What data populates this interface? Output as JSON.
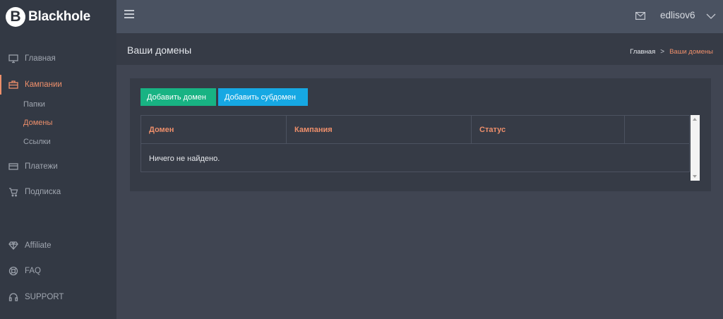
{
  "brand": {
    "logo_letter": "B",
    "name": "Blackhole"
  },
  "sidebar": {
    "items": [
      {
        "label": "Главная",
        "icon": "monitor-icon"
      },
      {
        "label": "Кампании",
        "icon": "briefcase-icon",
        "active": true
      },
      {
        "label": "Платежи",
        "icon": "credit-card-icon"
      },
      {
        "label": "Подписка",
        "icon": "cart-icon"
      },
      {
        "label": "Affiliate",
        "icon": "diamond-icon"
      },
      {
        "label": "FAQ",
        "icon": "lifebuoy-icon"
      },
      {
        "label": "SUPPORT",
        "icon": "headset-icon"
      }
    ],
    "sub_items": [
      {
        "label": "Папки"
      },
      {
        "label": "Домены",
        "active": true
      },
      {
        "label": "Ссылки"
      }
    ]
  },
  "topbar": {
    "username": "edlisov6",
    "menu_icon": "hamburger-icon",
    "mail_icon": "mail-icon",
    "dropdown_icon": "chevron-down-icon"
  },
  "page": {
    "title": "Ваши домены",
    "breadcrumb": {
      "home": "Главная",
      "separator": ">",
      "current": "Ваши домены"
    }
  },
  "actions": {
    "add_domain": "Добавить домен",
    "add_subdomain": "Добавить субдомен"
  },
  "table": {
    "columns": [
      "Домен",
      "Кампания",
      "Статус",
      ""
    ],
    "empty_message": "Ничего не найдено."
  },
  "colors": {
    "accent": "#ee8f6b",
    "green": "#18b383",
    "blue": "#16a8e3",
    "sidebar": "#333944",
    "background": "#404552"
  }
}
